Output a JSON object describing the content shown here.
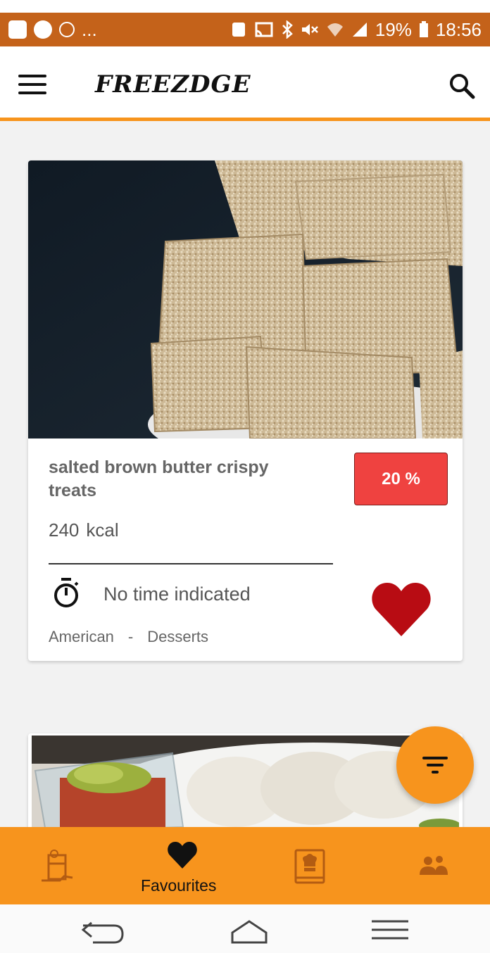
{
  "status_bar": {
    "left_dots": "...",
    "battery_pct": "19%",
    "time": "18:56",
    "color": "#c4621a"
  },
  "app_bar": {
    "title": "FREEZDGE",
    "accent": "#f7941d"
  },
  "recipe_card": {
    "title": "salted brown butter crispy treats",
    "discount": "20 %",
    "kcal_value": "240",
    "kcal_unit": "kcal",
    "time": "No time indicated",
    "cuisine": "American",
    "separator": "-",
    "category": "Desserts",
    "favourite": true,
    "heart_color": "#b80c13",
    "badge_color": "#ef4240"
  },
  "bottom_nav": {
    "items": [
      {
        "icon": "fridge-icon",
        "label": ""
      },
      {
        "icon": "heart-icon",
        "label": "Favourites",
        "active": true
      },
      {
        "icon": "recipe-book-icon",
        "label": ""
      },
      {
        "icon": "people-icon",
        "label": ""
      }
    ]
  },
  "system_nav": {
    "icons": [
      "back-icon",
      "home-icon",
      "recent-apps-icon"
    ]
  }
}
